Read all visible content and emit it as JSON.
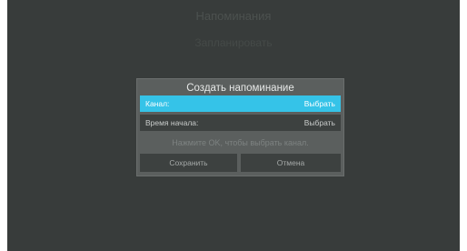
{
  "background": {
    "title": "Напоминания",
    "subtitle": "Запланировать"
  },
  "dialog": {
    "title": "Создать напоминание",
    "rows": [
      {
        "label": "Канал:",
        "value": "Выбрать"
      },
      {
        "label": "Время начала:",
        "value": "Выбрать"
      }
    ],
    "hint": "Нажмите OK, чтобы выбрать канал.",
    "buttons": {
      "save": "Сохранить",
      "cancel": "Отмена"
    }
  },
  "colors": {
    "highlight": "#35c3e8",
    "screen_bg": "#383c3b",
    "dialog_bg": "#5b5f5e",
    "row_bg": "#3d4140"
  }
}
